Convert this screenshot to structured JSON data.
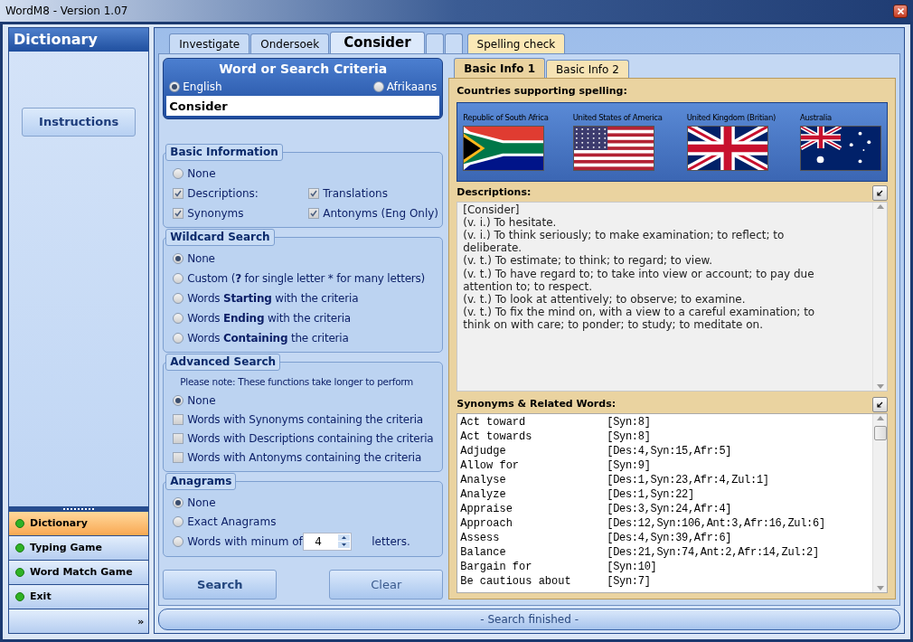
{
  "window": {
    "title": "WordM8 - Version 1.07"
  },
  "sidebar": {
    "title": "Dictionary",
    "instructions_button": "Instructions",
    "nav": [
      {
        "label": "Dictionary",
        "selected": true
      },
      {
        "label": "Typing Game",
        "selected": false
      },
      {
        "label": "Word Match Game",
        "selected": false
      },
      {
        "label": "Exit",
        "selected": false
      }
    ],
    "more": "»"
  },
  "tabs": [
    {
      "label": "Investigate",
      "selected": false
    },
    {
      "label": "Ondersoek",
      "selected": false
    },
    {
      "label": "Consider",
      "selected": true
    },
    {
      "selected": false
    },
    {
      "selected": false
    },
    {
      "label": "Spelling check",
      "selected": false
    }
  ],
  "criteria": {
    "title": "Word or Search Criteria",
    "languages": [
      {
        "label": "English",
        "selected": true
      },
      {
        "label": "Afrikaans",
        "selected": false
      }
    ],
    "value": "Consider"
  },
  "basic_information": {
    "title": "Basic Information",
    "none": {
      "label": "None",
      "selected": false
    },
    "options": [
      {
        "label": "Descriptions:",
        "checked": true
      },
      {
        "label": "Translations",
        "checked": true
      },
      {
        "label": "Synonyms",
        "checked": true
      },
      {
        "label": "Antonyms (Eng Only)",
        "checked": true
      }
    ]
  },
  "wildcard_search": {
    "title": "Wildcard Search",
    "options": [
      {
        "label": "None",
        "selected": true
      },
      {
        "label": "Custom (**?** for single letter * for many letters)",
        "selected": false
      },
      {
        "label": "Words **Starting** with the criteria",
        "selected": false
      },
      {
        "label": "Words **Ending** with the criteria",
        "selected": false
      },
      {
        "label": "Words **Containing** the criteria",
        "selected": false
      }
    ]
  },
  "advanced_search": {
    "title": "Advanced Search",
    "note": "Please note: These functions take longer to perform",
    "none": {
      "label": "None",
      "selected": true
    },
    "options": [
      {
        "label": "Words with Synonyms containing the criteria",
        "checked": false
      },
      {
        "label": "Words with Descriptions containing the criteria",
        "checked": false
      },
      {
        "label": "Words with Antonyms containing the criteria",
        "checked": false
      }
    ]
  },
  "anagrams": {
    "title": "Anagrams",
    "options": [
      {
        "label": "None",
        "selected": true
      },
      {
        "label": "Exact Anagrams",
        "selected": false
      },
      {
        "label": "Words with minum of",
        "selected": false
      }
    ],
    "min_letters": "4",
    "suffix": "letters."
  },
  "buttons": [
    "Search",
    "Clear"
  ],
  "info_tabs": [
    {
      "label": "Basic Info 1",
      "selected": true
    },
    {
      "label": "Basic Info 2",
      "selected": false
    }
  ],
  "countries": {
    "title": "Countries supporting spelling:",
    "items": [
      {
        "name": "Republic of South Africa",
        "kind": "za"
      },
      {
        "name": "United States of America",
        "kind": "us"
      },
      {
        "name": "United Kingdom (Britian)",
        "kind": "uk"
      },
      {
        "name": "Australia",
        "kind": "au"
      }
    ]
  },
  "descriptions": {
    "title": "Descriptions:",
    "lines": [
      "[Consider]",
      "(v. i.) To hesitate.",
      "(v. i.) To think seriously; to make examination; to reflect; to deliberate.",
      "(v. t.) To estimate; to think; to regard; to view.",
      "(v. t.) To have regard to; to take into view or account; to pay due attention to; to respect.",
      "(v. t.) To look at attentively; to observe; to examine.",
      "(v. t.) To fix the mind on, with a view to a careful examination; to think on with care; to ponder; to study; to meditate on."
    ]
  },
  "synonyms": {
    "title": "Synonyms & Related Words:",
    "rows": [
      {
        "word": "Act toward",
        "counts": "[Syn:8]"
      },
      {
        "word": "Act towards",
        "counts": "[Syn:8]"
      },
      {
        "word": "Adjudge",
        "counts": "[Des:4,Syn:15,Afr:5]"
      },
      {
        "word": "Allow for",
        "counts": "[Syn:9]"
      },
      {
        "word": "Analyse",
        "counts": "[Des:1,Syn:23,Afr:4,Zul:1]"
      },
      {
        "word": "Analyze",
        "counts": "[Des:1,Syn:22]"
      },
      {
        "word": "Appraise",
        "counts": "[Des:3,Syn:24,Afr:4]"
      },
      {
        "word": "Approach",
        "counts": "[Des:12,Syn:106,Ant:3,Afr:16,Zul:6]"
      },
      {
        "word": "Assess",
        "counts": "[Des:4,Syn:39,Afr:6]"
      },
      {
        "word": "Balance",
        "counts": "[Des:21,Syn:74,Ant:2,Afr:14,Zul:2]"
      },
      {
        "word": "Bargain for",
        "counts": "[Syn:10]"
      },
      {
        "word": "Be cautious about",
        "counts": "[Syn:7]"
      }
    ]
  },
  "status_bar": "- Search finished -"
}
